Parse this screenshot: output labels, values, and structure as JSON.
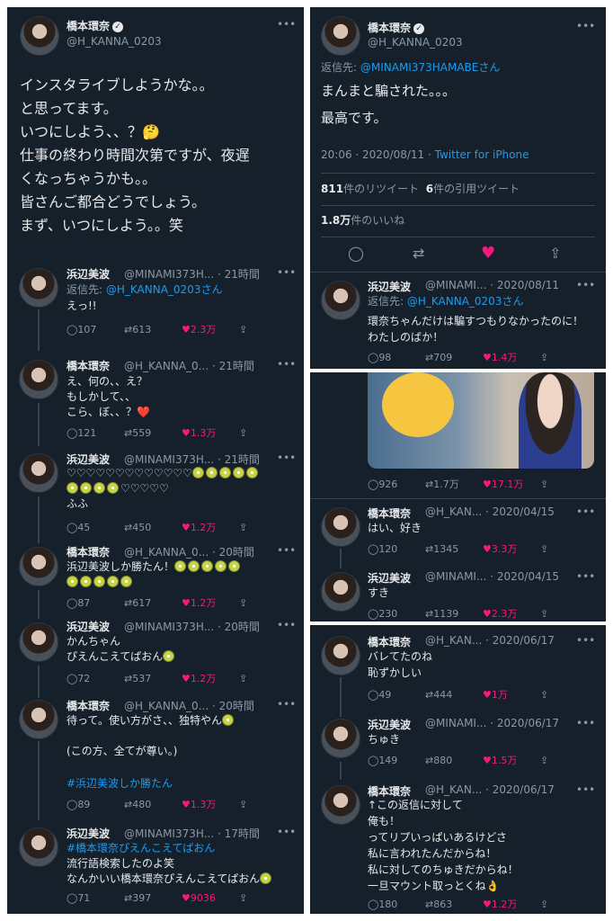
{
  "icons": {
    "more": "more-icon",
    "reply": "reply-icon",
    "retweet": "retweet-icon",
    "like": "heart-icon",
    "share": "share-icon",
    "verified": "verified-icon"
  },
  "colors": {
    "background": "#15202b",
    "text": "#e7e9ea",
    "muted": "#8b98a5",
    "link": "#1d9bf0",
    "like": "#f91880"
  },
  "left": {
    "main": {
      "name": "橋本環奈",
      "handle": "@H_KANNA_0203",
      "lines": [
        "インスタライブしようかな。。",
        "と思ってます。",
        "いつにしよう、、？🤔",
        "仕事の終わり時間次第ですが、夜遅",
        "くなっちゃうかも。。",
        "皆さんご都合どうでしょう。",
        "まず、いつにしよう。。笑"
      ]
    },
    "replies": [
      {
        "name": "浜辺美波",
        "meta": "@MINAMI373H... · 21時間",
        "reply_prefix": "返信先: ",
        "reply_to": "@H_KANNA_0203さん",
        "lines": [
          "えっ!!"
        ],
        "stats": {
          "replies": "107",
          "retweets": "613",
          "likes": "2.3万"
        }
      },
      {
        "name": "橋本環奈",
        "meta": "@H_KANNA_0... · 21時間",
        "lines": [
          "え、何の、、え？",
          "もしかして、、",
          "こら、ぼ、、？❤️"
        ],
        "stats": {
          "replies": "121",
          "retweets": "559",
          "likes": "1.3万"
        }
      },
      {
        "name": "浜辺美波",
        "meta": "@MINAMI373H... · 21時間",
        "lines": [
          "♡♡♡♡♡♡♡♡♡♡♡♡♡",
          "♡♡♡♡♡",
          "ふふ"
        ],
        "stats": {
          "replies": "45",
          "retweets": "450",
          "likes": "1.2万"
        }
      },
      {
        "name": "橋本環奈",
        "meta": "@H_KANNA_0... · 20時間",
        "lines": [
          "浜辺美波しか勝たん！"
        ],
        "stats": {
          "replies": "87",
          "retweets": "617",
          "likes": "1.2万"
        }
      },
      {
        "name": "浜辺美波",
        "meta": "@MINAMI373H... · 20時間",
        "lines": [
          "かんちゃん",
          "ぴえんこえてぱおん"
        ],
        "stats": {
          "replies": "72",
          "retweets": "537",
          "likes": "1.2万"
        }
      },
      {
        "name": "橋本環奈",
        "meta": "@H_KANNA_0... · 20時間",
        "lines": [
          "待って。使い方がさ、、独特やん",
          "(この方、全てが尊い。)"
        ],
        "hashtag": "#浜辺美波しか勝たん",
        "stats": {
          "replies": "89",
          "retweets": "480",
          "likes": "1.3万"
        }
      },
      {
        "name": "浜辺美波",
        "meta": "@MINAMI373H... · 17時間",
        "hashtag": "#橋本環奈ぴえんこえてぱおん",
        "lines": [
          "流行語検索したのよ笑",
          "なんかいい橋本環奈ぴえんこえてぱおん"
        ],
        "stats": {
          "replies": "71",
          "retweets": "397",
          "likes": "9036"
        }
      }
    ]
  },
  "right1": {
    "name": "橋本環奈",
    "handle": "@H_KANNA_0203",
    "reply_prefix": "返信先: ",
    "reply_to": "@MINAMI373HAMABEさん",
    "lines": [
      "まんまと騙された。。。",
      "最高です。"
    ],
    "time": "20:06 · 2020/08/11 · ",
    "client": "Twitter for iPhone",
    "retweets_num": "811",
    "retweets_label": "件のリツイート",
    "quotes_num": "6",
    "quotes_label": "件の引用ツイート",
    "likes_num": "1.8万",
    "likes_label": "件のいいね",
    "reply": {
      "name": "浜辺美波",
      "meta": "@MINAMI... · 2020/08/11",
      "reply_prefix": "返信先: ",
      "reply_to": "@H_KANNA_0203さん",
      "lines": [
        "環奈ちゃんだけは騙すつもりなかったのに！",
        "わたしのばか！"
      ],
      "stats": {
        "replies": "98",
        "retweets": "709",
        "likes": "1.4万"
      }
    }
  },
  "right2": {
    "photo_stats": {
      "replies": "926",
      "retweets": "1.7万",
      "likes": "17.1万"
    },
    "tweets": [
      {
        "name": "橋本環奈",
        "meta": "@H_KAN... · 2020/04/15",
        "lines": [
          "はい、好き"
        ],
        "stats": {
          "replies": "120",
          "retweets": "1345",
          "likes": "3.3万"
        }
      },
      {
        "name": "浜辺美波",
        "meta": "@MINAMI... · 2020/04/15",
        "lines": [
          "すき"
        ],
        "stats": {
          "replies": "230",
          "retweets": "1139",
          "likes": "2.3万"
        }
      }
    ]
  },
  "right3": {
    "tweets": [
      {
        "name": "橋本環奈",
        "meta": "@H_KAN... · 2020/06/17",
        "lines": [
          "バレてたのね",
          "恥ずかしい"
        ],
        "stats": {
          "replies": "49",
          "retweets": "444",
          "likes": "1万"
        }
      },
      {
        "name": "浜辺美波",
        "meta": "@MINAMI... · 2020/06/17",
        "lines": [
          "ちゅき"
        ],
        "stats": {
          "replies": "149",
          "retweets": "880",
          "likes": "1.5万"
        }
      },
      {
        "name": "橋本環奈",
        "meta": "@H_KAN... · 2020/06/17",
        "lines": [
          "↑この返信に対して",
          "俺も！",
          "ってリプいっぱいあるけどさ",
          "私に言われたんだからね！",
          "私に対してのちゅきだからね！",
          "一旦マウント取っとくね👌"
        ],
        "stats": {
          "replies": "180",
          "retweets": "863",
          "likes": "1.2万"
        }
      }
    ]
  }
}
